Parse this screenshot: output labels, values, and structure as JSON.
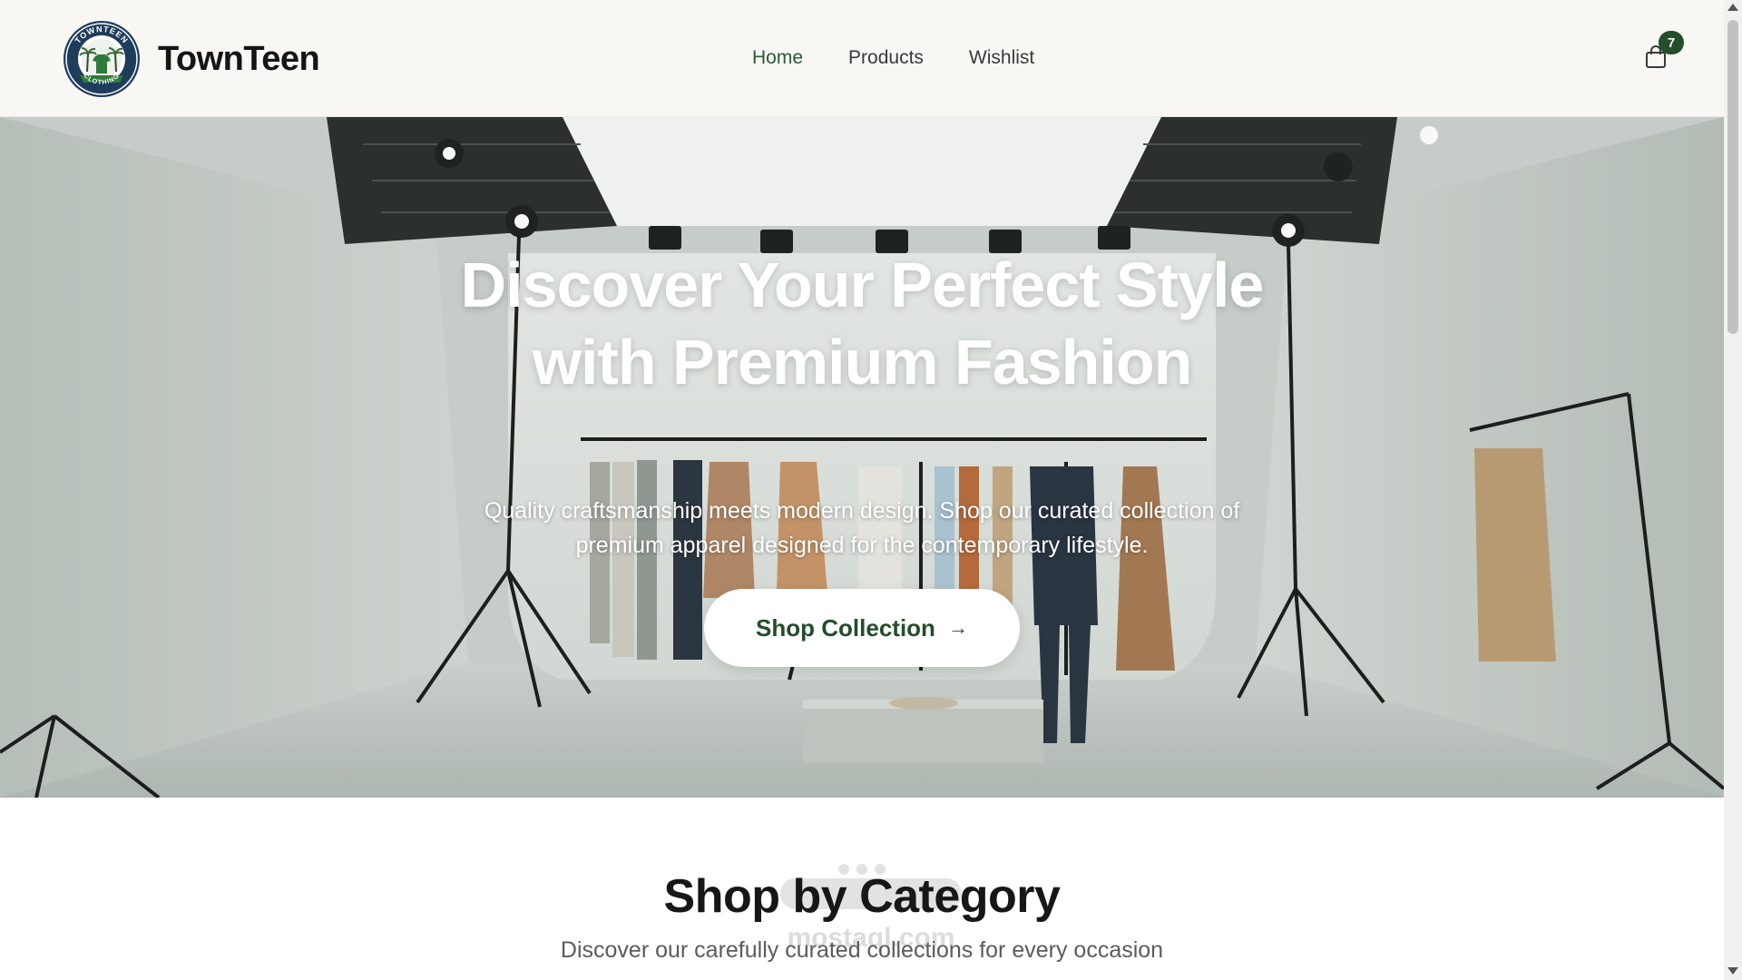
{
  "header": {
    "brand": "TownTeen",
    "logo_text_top": "TOWNTEEN",
    "logo_text_bottom": "CLOTHING",
    "nav": [
      {
        "label": "Home",
        "active": true
      },
      {
        "label": "Products",
        "active": false
      },
      {
        "label": "Wishlist",
        "active": false
      }
    ],
    "cart_icon": "shopping-bag-icon",
    "cart_count": "7"
  },
  "hero": {
    "title": "Discover Your Perfect Style with Premium Fashion",
    "subtitle": "Quality craftsmanship meets modern design. Shop our curated collection of premium apparel designed for the contemporary lifestyle.",
    "cta_label": "Shop Collection",
    "cta_icon": "arrow-right-icon"
  },
  "category": {
    "title": "Shop by Category",
    "subtitle": "Discover our carefully curated collections for every occasion"
  },
  "watermark": {
    "text": "mostaql.com"
  },
  "colors": {
    "accent": "#244d2c",
    "header_bg": "#f8f7f4",
    "nav_active": "#2a5a34"
  }
}
